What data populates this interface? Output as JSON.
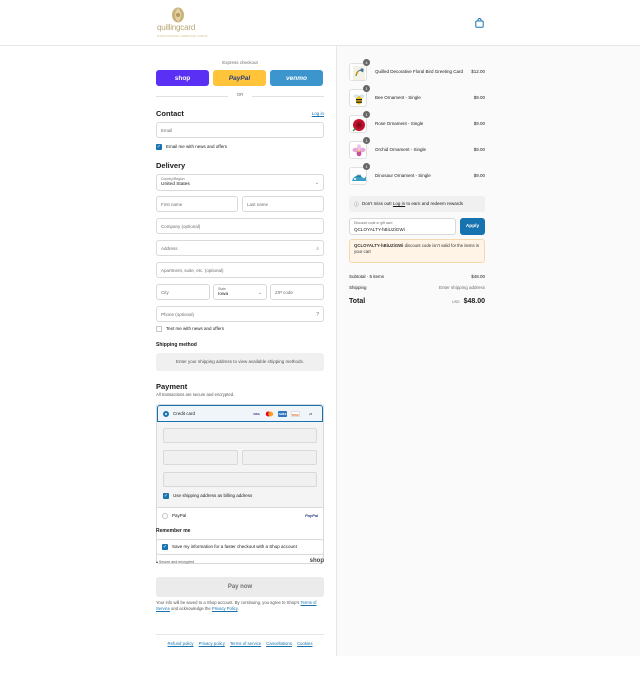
{
  "header": {
    "logo_text": "quillingcard",
    "logo_sub": "HANDCRAFTED GREETING CARDS"
  },
  "express": {
    "title": "Express checkout",
    "shop_label": "shop",
    "paypal_label": "PayPal",
    "venmo_label": "venmo",
    "or_label": "OR"
  },
  "contact": {
    "heading": "Contact",
    "login_link": "Log in",
    "email_placeholder": "Email",
    "news_label": "Email me with news and offers"
  },
  "delivery": {
    "heading": "Delivery",
    "country_label": "Country/Region",
    "country_value": "United States",
    "first_name": "First name",
    "last_name": "Last name",
    "company": "Company (optional)",
    "address": "Address",
    "apartment": "Apartment, suite, etc. (optional)",
    "city": "City",
    "state_label": "State",
    "state_value": "Iowa",
    "zip": "ZIP code",
    "phone": "Phone (optional)",
    "text_label": "Text me with news and offers"
  },
  "shipping": {
    "heading": "Shipping method",
    "placeholder": "Enter your shipping address to view available shipping methods."
  },
  "payment": {
    "heading": "Payment",
    "subtitle": "All transactions are secure and encrypted.",
    "credit_card_label": "Credit card",
    "card_logos": [
      "VISA",
      "MC",
      "AMEX",
      "DISC",
      "+5"
    ],
    "billing_label": "Use shipping address as billing address",
    "paypal_label": "PayPal",
    "paypal_logo": "PayPal"
  },
  "remember": {
    "heading": "Remember me",
    "save_label": "Save my information for a faster checkout with a Shop account",
    "secure_label": "Secure and encrypted",
    "shop_logo": "shop"
  },
  "pay_now": "Pay now",
  "legal": {
    "text_before": "Your info will be saved to a Shop account. By continuing, you agree to Shop's",
    "terms": "Terms of Service",
    "middle": "and acknowledge the",
    "privacy": "Privacy Policy",
    "end": "."
  },
  "footer": {
    "links": [
      "Refund policy",
      "Privacy policy",
      "Terms of service",
      "Cancellations",
      "Cookies"
    ]
  },
  "order": {
    "items": [
      {
        "name": "Quilled Decorative Floral Bird Greeting Card",
        "price": "$12.00",
        "qty": "4"
      },
      {
        "name": "Bee Ornament - Single",
        "price": "$9.00",
        "qty": "1"
      },
      {
        "name": "Rose Ornament - Single",
        "price": "$9.00",
        "qty": "1"
      },
      {
        "name": "Orchid Ornament - Single",
        "price": "$9.00",
        "qty": "1"
      },
      {
        "name": "Dinosaur Ornament - Single",
        "price": "$9.00",
        "qty": "1"
      }
    ],
    "loyalty_before": "Don't miss out!",
    "loyalty_link": "Log in",
    "loyalty_after": "to earn and redeem rewards",
    "discount_label": "Discount code or gift card",
    "discount_value": "QCLOYALTY-hBiUZiGWi",
    "apply_label": "Apply",
    "warning_code": "QCLOYALTY-hBiUZiGWi",
    "warning_text": "discount code isn't valid for the items in your cart",
    "subtotal_label": "Subtotal · 5 items",
    "subtotal_value": "$48.00",
    "shipping_label": "Shipping",
    "shipping_value": "Enter shipping address",
    "total_label": "Total",
    "currency": "USD",
    "total_value": "$48.00"
  },
  "colors": {
    "accent": "#1773b0",
    "shop": "#5a31f4",
    "paypal": "#ffc439",
    "venmo": "#3d95ce"
  }
}
